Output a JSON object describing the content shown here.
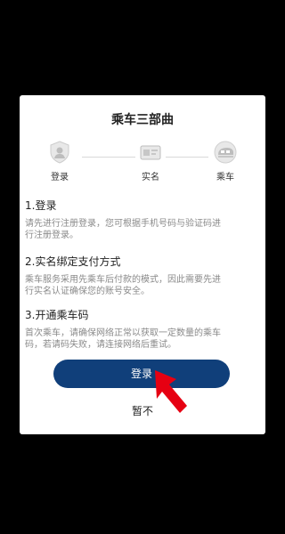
{
  "dialog": {
    "title": "乘车三部曲",
    "steps": [
      {
        "label": "登录",
        "icon": "user-shield-icon"
      },
      {
        "label": "实名",
        "icon": "id-card-icon"
      },
      {
        "label": "乘车",
        "icon": "train-icon"
      }
    ],
    "sections": [
      {
        "heading": "1.登录",
        "text_line1": "请先进行注册登录，您可根据手机号码与验证码进",
        "text_line2": "行注册登录。"
      },
      {
        "heading": "2.实名绑定支付方式",
        "text_line1": "乘车服务采用先乘车后付款的模式，因此需要先进",
        "text_line2": "行实名认证确保您的账号安全。"
      },
      {
        "heading": "3.开通乘车码",
        "text_line1": "首次乘车，请确保网络正常以获取一定数量的乘车",
        "text_line2": "码，若请码失败，请连接网络后重试。"
      }
    ],
    "login_button": "登录",
    "later_button": "暂不"
  },
  "colors": {
    "button_primary": "#103f7a",
    "pointer_arrow": "#e60012",
    "background": "#000000"
  }
}
